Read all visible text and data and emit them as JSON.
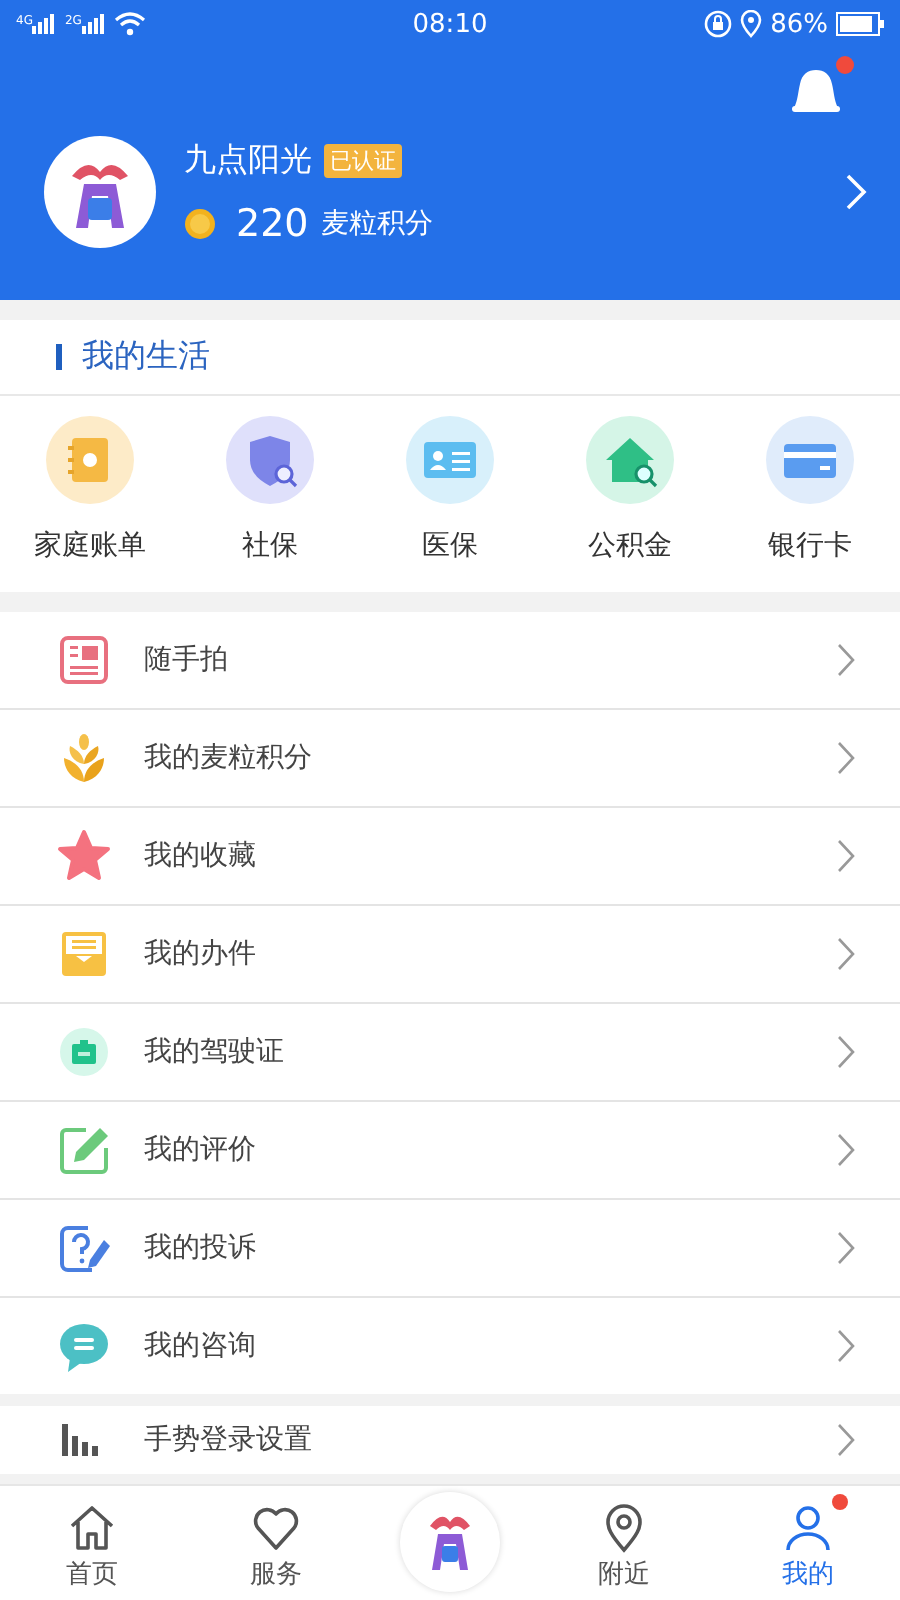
{
  "status_bar": {
    "networks": [
      "4G",
      "2G"
    ],
    "time": "08:10",
    "battery": "86%"
  },
  "profile": {
    "name": "九点阳光",
    "badge": "已认证",
    "points": "220",
    "points_label": "麦粒积分",
    "notification": true
  },
  "section": {
    "title": "我的生活"
  },
  "services": [
    {
      "kind": "ledger",
      "label": "家庭账单"
    },
    {
      "kind": "shield",
      "label": "社保"
    },
    {
      "kind": "idcard",
      "label": "医保"
    },
    {
      "kind": "house",
      "label": "公积金"
    },
    {
      "kind": "bankcard",
      "label": "银行卡"
    }
  ],
  "menu": [
    {
      "kind": "news",
      "label": "随手拍"
    },
    {
      "kind": "wheat",
      "label": "我的麦粒积分"
    },
    {
      "kind": "star",
      "label": "我的收藏"
    },
    {
      "kind": "inbox",
      "label": "我的办件"
    },
    {
      "kind": "license",
      "label": "我的驾驶证"
    },
    {
      "kind": "edit",
      "label": "我的评价"
    },
    {
      "kind": "question",
      "label": "我的投诉"
    },
    {
      "kind": "chat",
      "label": "我的咨询"
    }
  ],
  "settings": [
    {
      "kind": "bars",
      "label": "手势登录设置"
    }
  ],
  "tabs": [
    {
      "kind": "home",
      "label": "首页",
      "selected": false,
      "badge": false
    },
    {
      "kind": "heart",
      "label": "服务",
      "selected": false,
      "badge": false
    },
    {
      "kind": "center",
      "selected": false,
      "badge": false
    },
    {
      "kind": "pin",
      "label": "附近",
      "selected": false,
      "badge": false
    },
    {
      "kind": "user",
      "label": "我的",
      "selected": true,
      "badge": true
    }
  ]
}
